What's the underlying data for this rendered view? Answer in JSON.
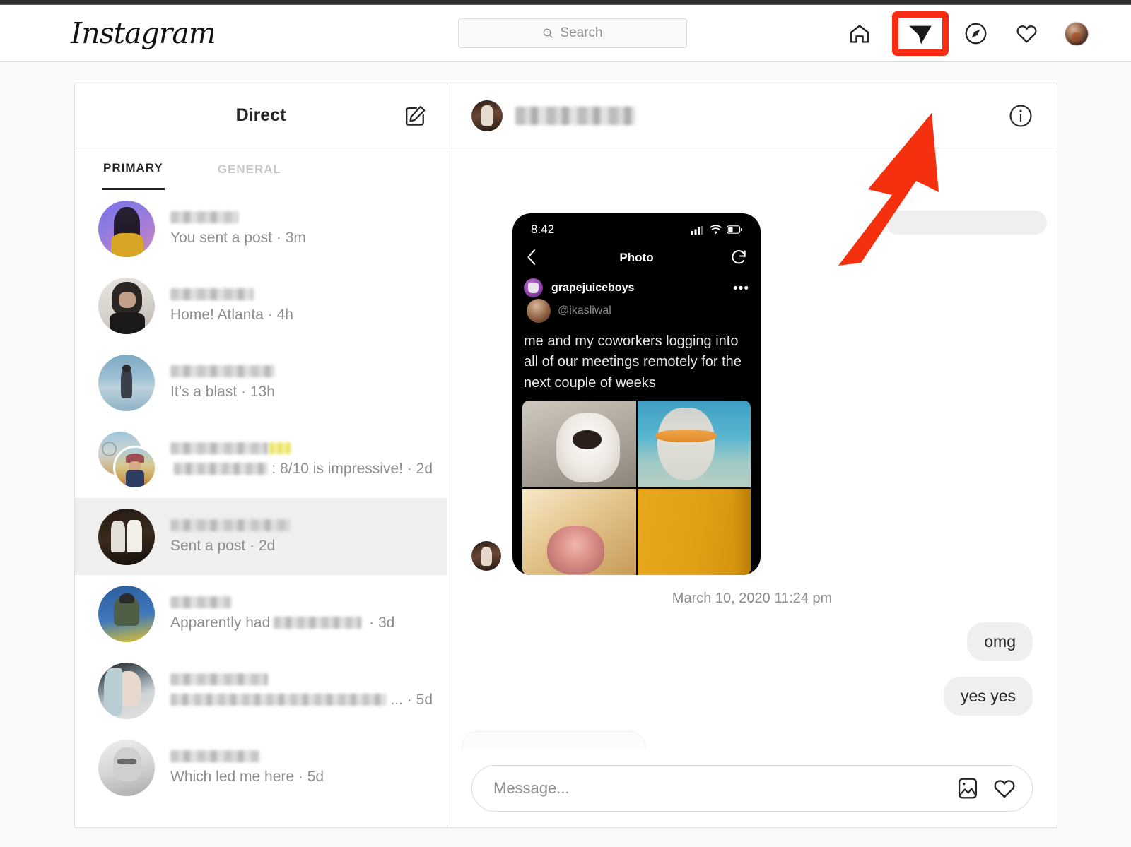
{
  "nav": {
    "logo": "Instagram",
    "search_placeholder": "Search",
    "icons": [
      {
        "name": "home-icon",
        "label": "Home"
      },
      {
        "name": "direct-messages-icon",
        "label": "Direct"
      },
      {
        "name": "explore-compass-icon",
        "label": "Explore"
      },
      {
        "name": "activity-heart-icon",
        "label": "Activity"
      },
      {
        "name": "profile-avatar",
        "label": "Profile"
      }
    ]
  },
  "annotation": {
    "highlight_color": "#f72c12",
    "target": "direct-messages-icon",
    "arrow": "red-arrow-pointing-to-direct-icon"
  },
  "inbox": {
    "title": "Direct",
    "compose_label": "New Message",
    "tabs": [
      {
        "label": "PRIMARY",
        "active": true
      },
      {
        "label": "GENERAL",
        "active": false
      }
    ],
    "threads": [
      {
        "name_redacted": true,
        "preview": "You sent a post",
        "time": "3m",
        "selected": false,
        "avatar": "purple-portrait",
        "group": false
      },
      {
        "name_redacted": true,
        "preview": "Home! Atlanta",
        "time": "4h",
        "selected": false,
        "avatar": "mirror-selfie",
        "group": false
      },
      {
        "name_redacted": true,
        "preview": "It’s a blast",
        "time": "13h",
        "selected": false,
        "avatar": "beach-portrait",
        "group": false
      },
      {
        "name_redacted": true,
        "preview_suffix": ": 8/10 is impressive!",
        "preview_has_redaction": true,
        "time": "2d",
        "selected": false,
        "avatar": "group-two-photos",
        "group": true
      },
      {
        "name_redacted": true,
        "preview": "Sent a post",
        "time": "2d",
        "selected": true,
        "avatar": "night-two-people",
        "group": false
      },
      {
        "name_redacted": true,
        "preview_prefix": "Apparently had",
        "preview_has_redaction": true,
        "time": "3d",
        "selected": false,
        "avatar": "blue-kayak",
        "group": false
      },
      {
        "name_redacted": true,
        "preview_redacted": true,
        "preview_ellipsis": "...",
        "time": "5d",
        "selected": false,
        "avatar": "blue-hair-portrait",
        "group": false
      },
      {
        "name_redacted": true,
        "preview": "Which led me here",
        "time": "5d",
        "selected": false,
        "avatar": "bw-glasses-portrait",
        "group": false
      }
    ]
  },
  "conversation": {
    "name_redacted": true,
    "info_label": "Conversation information",
    "shared_post": {
      "type": "phone-screenshot",
      "status_time": "8:42",
      "screen_title": "Photo",
      "account": "grapejuiceboys",
      "handle": "@ikasliwal",
      "caption": "me and my coworkers logging into all of our meetings remotely for the next couple of weeks",
      "grid_cells": [
        "white-dog",
        "orange-fish",
        "pink-nose",
        "yellow-panel"
      ]
    },
    "timestamp": "March 10, 2020 11:24 pm",
    "messages": [
      {
        "text": "omg",
        "outgoing": true
      },
      {
        "text": "yes yes",
        "outgoing": true
      }
    ]
  },
  "composer": {
    "placeholder": "Message...",
    "photo_label": "Add photo",
    "like_label": "Send like"
  }
}
